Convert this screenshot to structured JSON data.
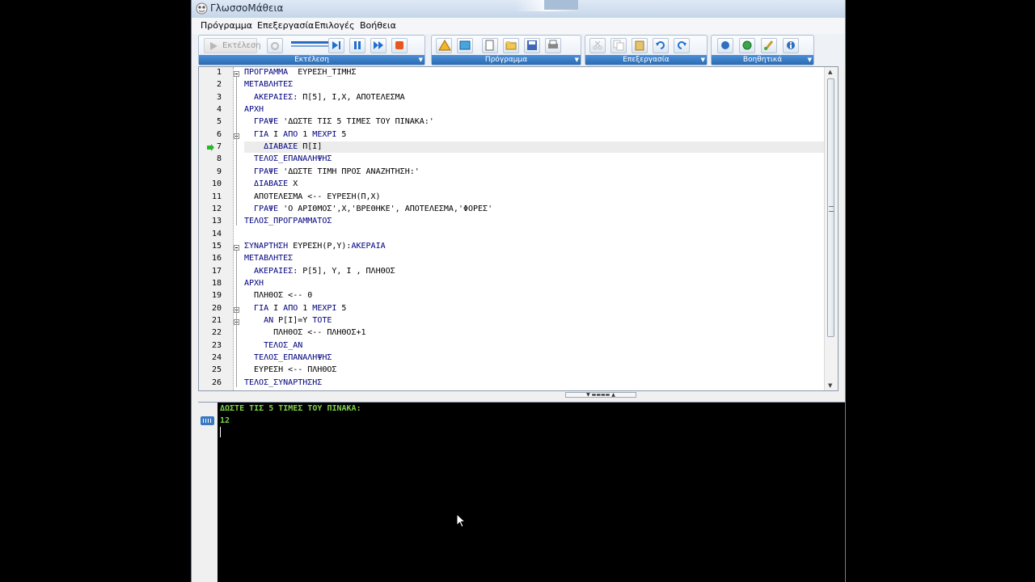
{
  "window": {
    "title": "ΓλωσσοΜάθεια"
  },
  "menu": [
    {
      "label": "Πρόγραμμα"
    },
    {
      "label": "Επεξεργασία"
    },
    {
      "label": "Επιλογές"
    },
    {
      "label": "Βοήθεια"
    }
  ],
  "toolbars": {
    "run": {
      "caption": "Εκτέλεση",
      "run_label": "Εκτέλεση"
    },
    "program": {
      "caption": "Πρόγραμμα"
    },
    "edit": {
      "caption": "Επεξεργασία"
    },
    "help": {
      "caption": "Βοηθητικά"
    }
  },
  "editor": {
    "current_line": 7,
    "lines": [
      "ΠΡΟΓΡΑΜΜΑ  ΕΥΡΕΣΗ_ΤΙΜΗΣ",
      "ΜΕΤΑΒΛΗΤΕΣ",
      "  ΑΚΕΡΑΙΕΣ: Π[5], Ι,Χ, ΑΠΟΤΕΛΕΣΜΑ",
      "ΑΡΧΗ",
      "  ΓΡΑΨΕ 'ΔΩΣΤΕ ΤΙΣ 5 ΤΙΜΕΣ ΤΟΥ ΠΙΝΑΚΑ:'",
      "  ΓΙΑ Ι ΑΠΟ 1 ΜΕΧΡΙ 5",
      "    ΔΙΑΒΑΣΕ Π[Ι]",
      "  ΤΕΛΟΣ_ΕΠΑΝΑΛΗΨΗΣ",
      "  ΓΡΑΨΕ 'ΔΩΣΤΕ ΤΙΜΗ ΠΡΟΣ ΑΝΑΖΗΤΗΣΗ:'",
      "  ΔΙΑΒΑΣΕ Χ",
      "  ΑΠΟΤΕΛΕΣΜΑ <-- ΕΥΡΕΣΗ(Π,Χ)",
      "  ΓΡΑΨΕ 'Ο ΑΡΙΘΜΟΣ',Χ,'ΒΡΕΘΗΚΕ', ΑΠΟΤΕΛΕΣΜΑ,'ΦΟΡΕΣ'",
      "ΤΕΛΟΣ_ΠΡΟΓΡΑΜΜΑΤΟΣ",
      "",
      "ΣΥΝΑΡΤΗΣΗ ΕΥΡΕΣΗ(Ρ,Υ):ΑΚΕΡΑΙΑ",
      "ΜΕΤΑΒΛΗΤΕΣ",
      "  ΑΚΕΡΑΙΕΣ: Ρ[5], Υ, Ι , ΠΛΗΘΟΣ",
      "ΑΡΧΗ",
      "  ΠΛΗΘΟΣ <-- 0",
      "  ΓΙΑ Ι ΑΠΟ 1 ΜΕΧΡΙ 5",
      "    ΑΝ Ρ[Ι]=Υ ΤΟΤΕ",
      "      ΠΛΗΘΟΣ <-- ΠΛΗΘΟΣ+1",
      "    ΤΕΛΟΣ_ΑΝ",
      "  ΤΕΛΟΣ_ΕΠΑΝΑΛΗΨΗΣ",
      "  ΕΥΡΕΣΗ <-- ΠΛΗΘΟΣ",
      "ΤΕΛΟΣ_ΣΥΝΑΡΤΗΣΗΣ"
    ],
    "folds": [
      1,
      6,
      15,
      20,
      21
    ]
  },
  "console": {
    "lines": [
      {
        "text": "ΔΩΣΤΕ ΤΙΣ 5 ΤΙΜΕΣ ΤΟΥ ΠΙΝΑΚΑ:",
        "color": "#7fd34b"
      },
      {
        "text": "12",
        "color": "#7fd34b"
      }
    ]
  },
  "colors": {
    "keyword": "#00007f",
    "caption_bar": "#2a6bb4",
    "console_text": "#7fd34b"
  }
}
